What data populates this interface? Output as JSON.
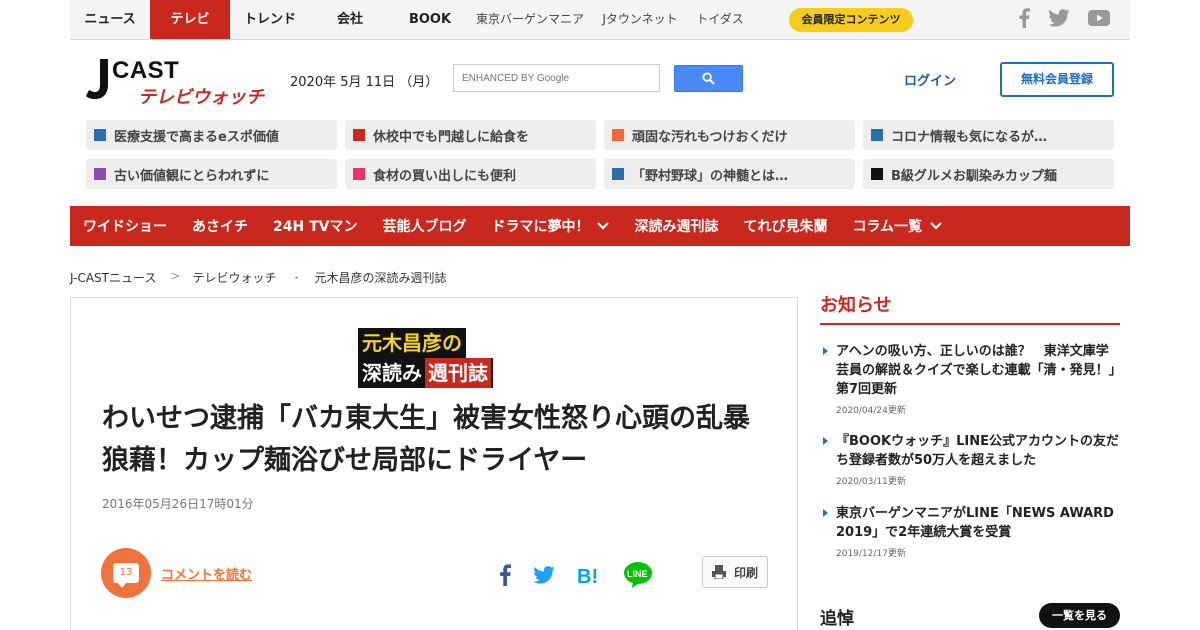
{
  "top_nav": {
    "items": [
      {
        "label": "ニュース"
      },
      {
        "label": "テレビ"
      },
      {
        "label": "トレンド"
      },
      {
        "label": "会社"
      },
      {
        "label": "BOOK"
      },
      {
        "label": "東京バーゲンマニア"
      },
      {
        "label": "Jタウンネット"
      },
      {
        "label": "トイダス"
      }
    ],
    "members_label": "会員限定コンテンツ",
    "social_icons": [
      "facebook-icon",
      "twitter-icon",
      "youtube-icon"
    ]
  },
  "header": {
    "logo_top": "J-CAST",
    "logo_sub": "テレビウォッチ",
    "date": "2020年 5月 11日 （月）",
    "search_placeholder": "ENHANCED BY Google",
    "login": "ログイン",
    "register": "無料会員登録"
  },
  "promo_tiles": [
    {
      "label": "医療支援で高まるeスポ価値",
      "color": "#2a6faa"
    },
    {
      "label": "休校中でも門越しに給食を",
      "color": "#c8281e"
    },
    {
      "label": "頑固な汚れもつけおくだけ",
      "color": "#ee6a3a"
    },
    {
      "label": "コロナ情報も気になるが…",
      "color": "#2a6faa"
    },
    {
      "label": "古い価値観にとらわれずに",
      "color": "#8e4bb0"
    },
    {
      "label": "食材の買い出しにも便利",
      "color": "#e8336a"
    },
    {
      "label": "「野村野球」の神髄とは…",
      "color": "#2a6faa"
    },
    {
      "label": "B級グルメお馴染みカップ麺",
      "color": "#111111"
    }
  ],
  "red_nav": [
    {
      "label": "ワイドショー",
      "dropdown": false
    },
    {
      "label": "あさイチ",
      "dropdown": false
    },
    {
      "label": "24H TVマン",
      "dropdown": false
    },
    {
      "label": "芸能人ブログ",
      "dropdown": false
    },
    {
      "label": "ドラマに夢中！",
      "dropdown": true
    },
    {
      "label": "深読み週刊誌",
      "dropdown": false
    },
    {
      "label": "てれび見朱蘭",
      "dropdown": false
    },
    {
      "label": "コラム一覧",
      "dropdown": true
    }
  ],
  "breadcrumb": [
    "J-CASTニュース",
    "テレビウォッチ",
    "元木昌彦の深読み週刊誌"
  ],
  "article": {
    "badge_line1": "元木昌彦の",
    "badge_line2a": "深読み",
    "badge_line2b": "週刊誌",
    "title": "わいせつ逮捕「バカ東大生」被害女性怒り心頭の乱暴狼藉！カップ麺浴びせ局部にドライヤー",
    "date": "2016年05月26日17時01分",
    "comment_count": "13",
    "comment_link": "コメントを読む",
    "print_label": "印刷"
  },
  "sidebar": {
    "heading": "お知らせ",
    "news": [
      {
        "title": "アヘンの吸い方、正しいのは誰？　東洋文庫学芸員の解説＆クイズで楽しむ連載「清・発見！」第7回更新",
        "date": "2020/04/24更新"
      },
      {
        "title": "『BOOKウォッチ』LINE公式アカウントの友だち登録者数が50万人を超えました",
        "date": "2020/03/11更新"
      },
      {
        "title": "東京バーゲンマニアがLINE「NEWS AWARD 2019」で2年連続大賞を受賞",
        "date": "2019/12/17更新"
      }
    ],
    "mourn_heading": "追悼",
    "list_button": "一覧を見る"
  }
}
